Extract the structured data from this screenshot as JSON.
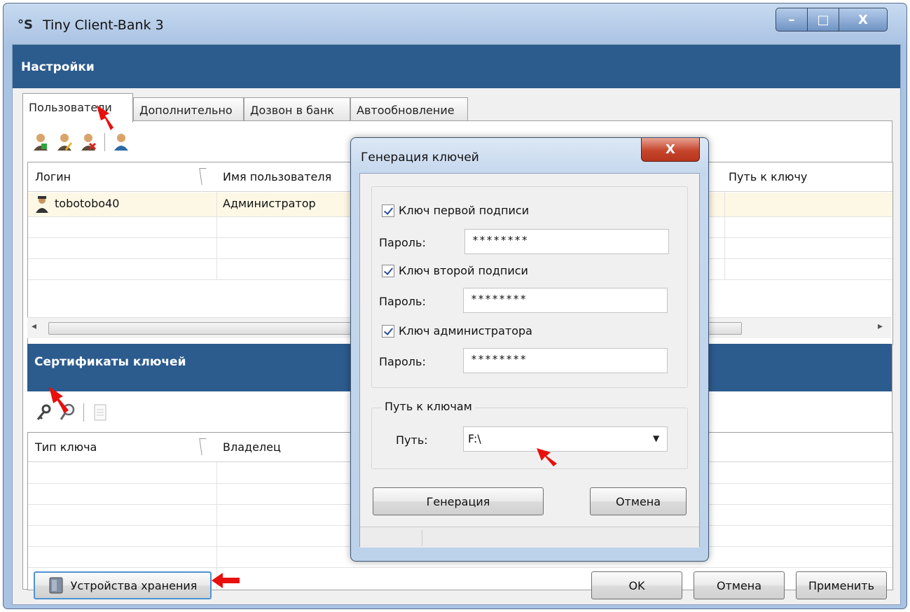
{
  "window": {
    "title": "Tiny Client-Bank 3",
    "icon_text": "°S",
    "minimize": "–",
    "maximize": "□",
    "close": "X"
  },
  "settings": {
    "header": "Настройки",
    "tabs": [
      {
        "label": "Пользователи",
        "active": true
      },
      {
        "label": "Дополнительно",
        "active": false
      },
      {
        "label": "Дозвон в банк",
        "active": false
      },
      {
        "label": "Автообновление",
        "active": false
      }
    ]
  },
  "users_toolbar": {
    "icons": [
      "add-user-icon",
      "edit-user-icon",
      "delete-user-icon",
      "user-icon"
    ]
  },
  "users_table": {
    "columns": [
      "Логин",
      "Имя пользователя",
      "Путь к ключу"
    ],
    "rows": [
      {
        "login": "tobotobo40",
        "name": "Администратор"
      }
    ]
  },
  "scroll": {
    "left": "◂",
    "right": "▸"
  },
  "certificates": {
    "header": "Сертификаты ключей",
    "toolbar_icons": [
      "key-icon",
      "search-icon",
      "document-icon"
    ],
    "columns": [
      "Тип ключа",
      "Владелец"
    ]
  },
  "bottom_buttons": {
    "storage": "Устройства хранения",
    "ok": "OK",
    "cancel": "Отмена",
    "apply": "Применить"
  },
  "dialog": {
    "title": "Генерация ключей",
    "close": "X",
    "keys": [
      {
        "label": "Ключ первой подписи",
        "checked": true,
        "password_label": "Пароль:",
        "password": "********"
      },
      {
        "label": "Ключ второй подписи",
        "checked": true,
        "password_label": "Пароль:",
        "password": "********"
      },
      {
        "label": "Ключ администратора",
        "checked": true,
        "password_label": "Пароль:",
        "password": "********"
      }
    ],
    "path_group": "Путь к ключам",
    "path_label": "Путь:",
    "path_value": "F:\\",
    "path_dropdown": "▼",
    "generate": "Генерация",
    "cancel": "Отмена"
  },
  "colors": {
    "header_blue": "#2c5b8d",
    "arrow_red": "#e8100c",
    "selected_row": "#fdf8e6"
  }
}
